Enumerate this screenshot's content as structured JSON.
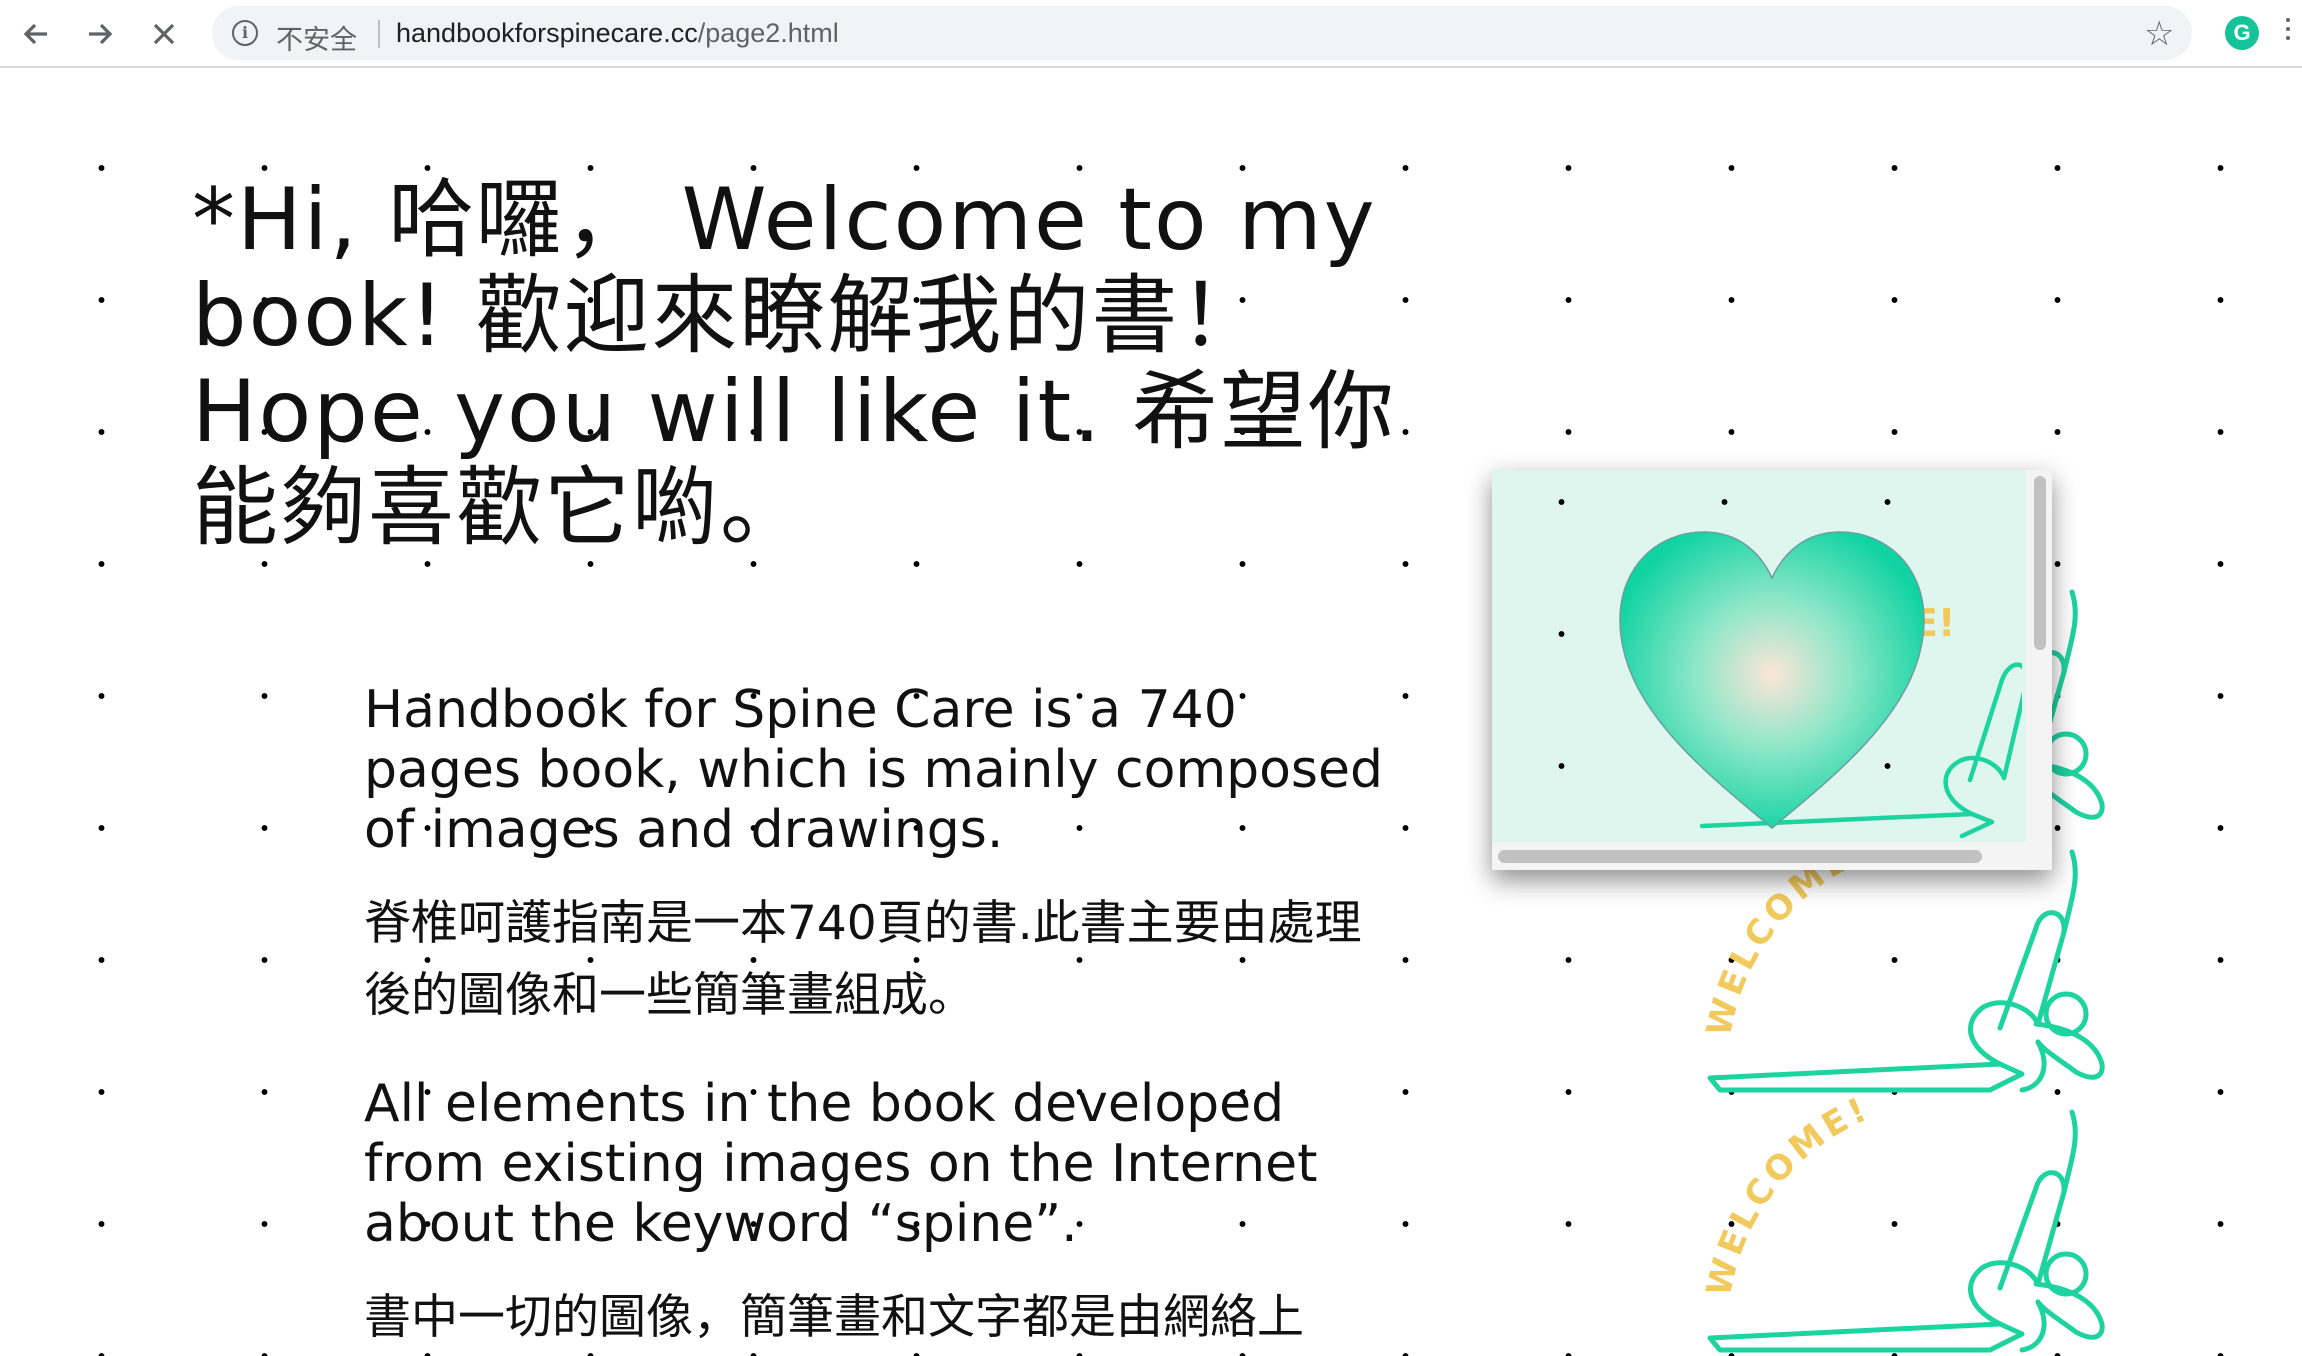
{
  "browser": {
    "back_icon": "arrow-left-icon",
    "forward_icon": "arrow-right-icon",
    "stop_icon": "close-icon",
    "security_label": "不安全",
    "url_domain": "handbookforspinecare.cc",
    "url_path": "/page2.html",
    "bookmark_icon": "star-icon",
    "extension_icon": "grammarly-icon",
    "extension_letter": "G"
  },
  "page": {
    "headline": "*Hi, 哈囉， Welcome to my book! 歡迎來瞭解我的書！Hope you will like it. 希望你能夠喜歡它喲。",
    "paragraphs": {
      "p1": "Handbook for Spine Care is a 740 pages book, which is mainly composed of images and drawings.",
      "p2": "脊椎呵護指南是一本740頁的書.此書主要由處理後的圖像和一些簡筆畫組成。",
      "p3": "All elements in the book developed from existing images on the Internet about the keyword “spine”.",
      "p4": "書中一切的圖像，簡筆畫和文字都是由網絡上"
    },
    "decoration_text": "WELCOME!"
  },
  "popup": {
    "image": "heart-icon",
    "partial_text": "E!"
  },
  "colors": {
    "accent_green": "#1dd3a0",
    "welcome_yellow": "#f2c95b",
    "popup_bg": "#dff6ef"
  }
}
